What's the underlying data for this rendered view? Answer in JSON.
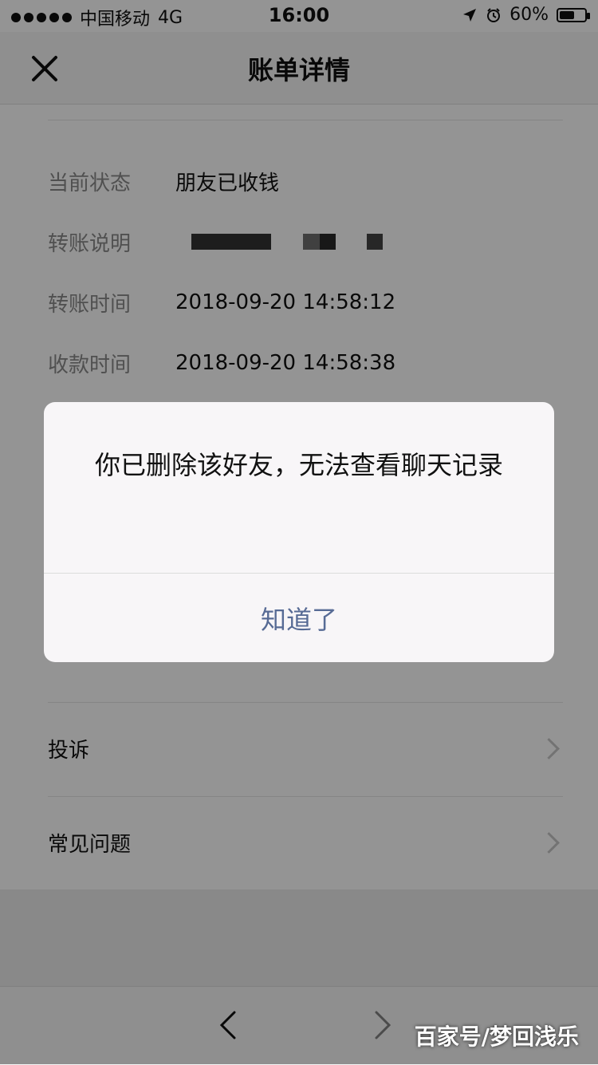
{
  "status_bar": {
    "carrier": "中国移动",
    "network": "4G",
    "time": "16:00",
    "battery_text": "60%",
    "battery_level": 0.6,
    "location_icon": "location-arrow-icon",
    "alarm_icon": "alarm-clock-icon"
  },
  "header": {
    "title": "账单详情",
    "close_icon": "close-icon"
  },
  "details": [
    {
      "label": "当前状态",
      "value": "朋友已收钱"
    },
    {
      "label": "转账说明",
      "value": ""
    },
    {
      "label": "转账时间",
      "value": "2018-09-20 14:58:12"
    },
    {
      "label": "收款时间",
      "value": "2018-09-20 14:58:38"
    }
  ],
  "list": [
    {
      "label": "投诉"
    },
    {
      "label": "常见问题"
    }
  ],
  "dialog": {
    "message": "你已删除该好友，无法查看聊天记录",
    "button": "知道了",
    "button_color": "#576b95"
  },
  "watermark": "百家号/梦回浅乐"
}
